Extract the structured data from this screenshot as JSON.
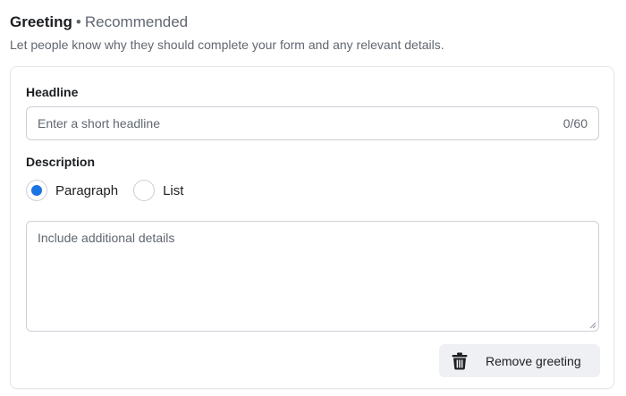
{
  "section": {
    "title": "Greeting",
    "separator": "•",
    "tag": "Recommended",
    "description": "Let people know why they should complete your form and any relevant details."
  },
  "headline": {
    "label": "Headline",
    "placeholder": "Enter a short headline",
    "value": "",
    "counter": "0/60"
  },
  "description": {
    "label": "Description",
    "options": [
      {
        "label": "Paragraph",
        "selected": true
      },
      {
        "label": "List",
        "selected": false
      }
    ],
    "placeholder": "Include additional details",
    "value": ""
  },
  "actions": {
    "remove_label": "Remove greeting",
    "remove_icon": "trash-icon"
  },
  "colors": {
    "accent": "#1b74e4",
    "text": "#1c1e21",
    "secondary_text": "#606770",
    "border": "#ccd0d5",
    "button_bg": "#eef0f3"
  }
}
